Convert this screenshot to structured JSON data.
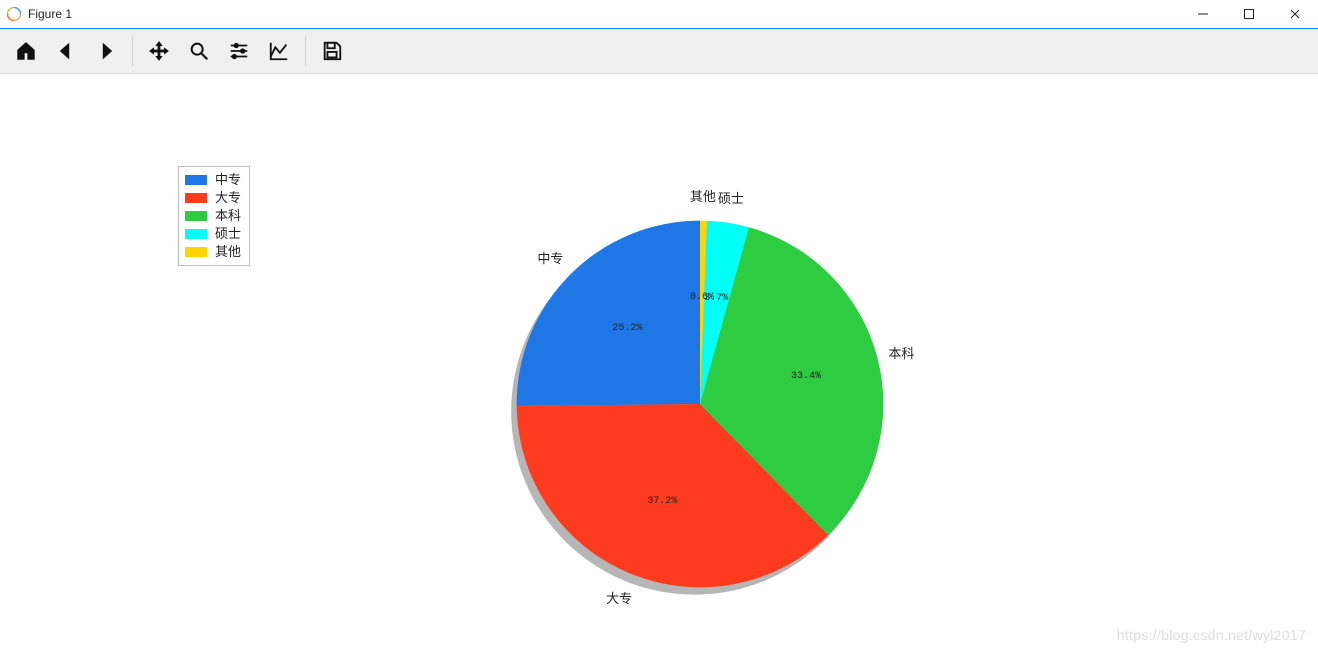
{
  "window": {
    "title": "Figure 1"
  },
  "toolbar": {
    "home": "Home",
    "back": "Back",
    "forward": "Forward",
    "pan": "Pan",
    "zoom": "Zoom",
    "configure": "Configure subplots",
    "edit": "Edit axis",
    "save": "Save"
  },
  "legend": {
    "items": [
      {
        "label": "中专",
        "color": "#1f77e6"
      },
      {
        "label": "大专",
        "color": "#ff3b1f"
      },
      {
        "label": "本科",
        "color": "#2ecc40"
      },
      {
        "label": "硕士",
        "color": "#00fff7"
      },
      {
        "label": "其他",
        "color": "#ffd400"
      }
    ]
  },
  "chart_data": {
    "type": "pie",
    "series": [
      {
        "name": "中专",
        "value": 25.2,
        "pct_label": "25.2%",
        "color": "#1f77e6"
      },
      {
        "name": "大专",
        "value": 37.2,
        "pct_label": "37.2%",
        "color": "#ff3b1f"
      },
      {
        "name": "本科",
        "value": 33.4,
        "pct_label": "33.4%",
        "color": "#2ecc40"
      },
      {
        "name": "硕士",
        "value": 3.7,
        "pct_label": "3.7%",
        "color": "#00fff7"
      },
      {
        "name": "其他",
        "value": 0.6,
        "pct_label": "0.6%",
        "color": "#ffd400"
      }
    ],
    "start_angle_deg": 90,
    "direction": "ccw",
    "shadow": true
  },
  "watermark": "https://blog.csdn.net/wyl2017"
}
